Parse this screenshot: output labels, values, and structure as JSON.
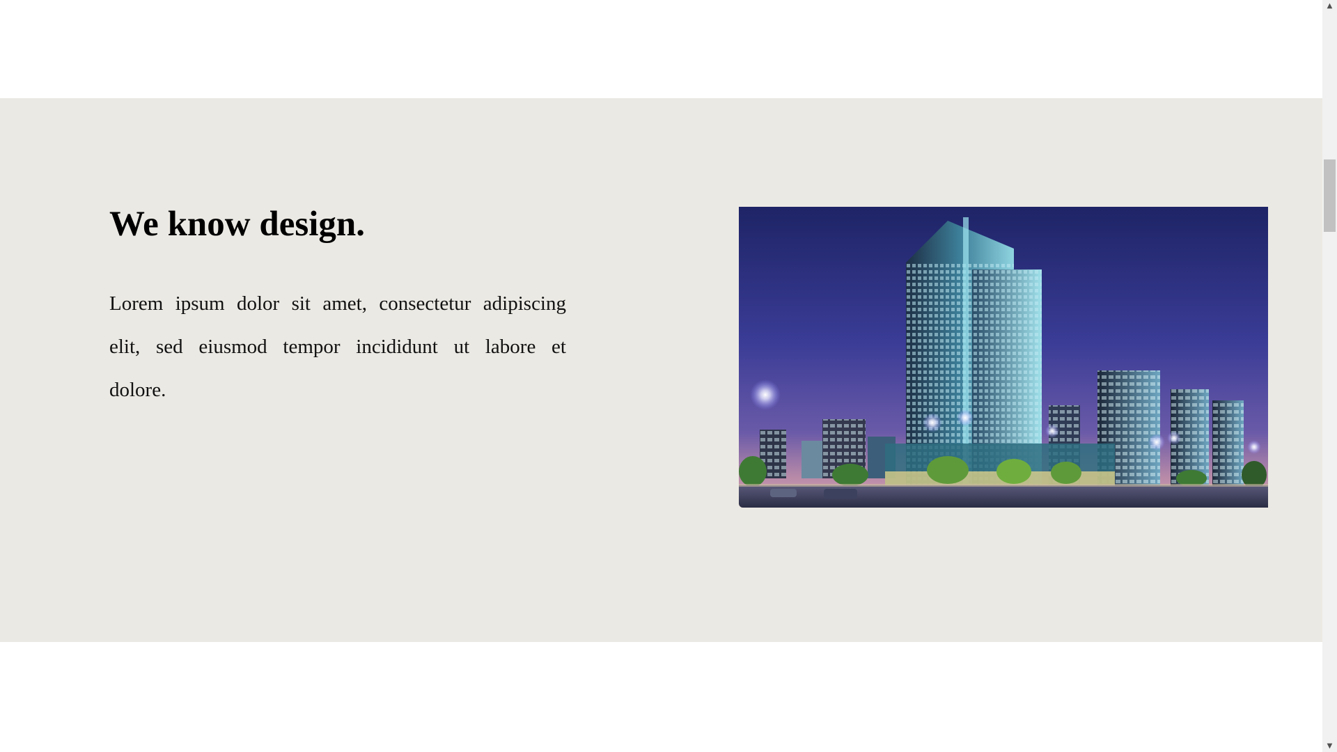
{
  "section": {
    "title": "We know design.",
    "body": "Lorem ipsum dolor sit amet, consectetur adipiscing elit, sed eiusmod tempor incididunt ut labore et dolore.",
    "background_color": "#ebe9e3"
  },
  "image": {
    "subject": "night-cityscape-highrise-buildings"
  },
  "scrollbar": {
    "up_icon": "▲",
    "down_icon": "▼"
  }
}
